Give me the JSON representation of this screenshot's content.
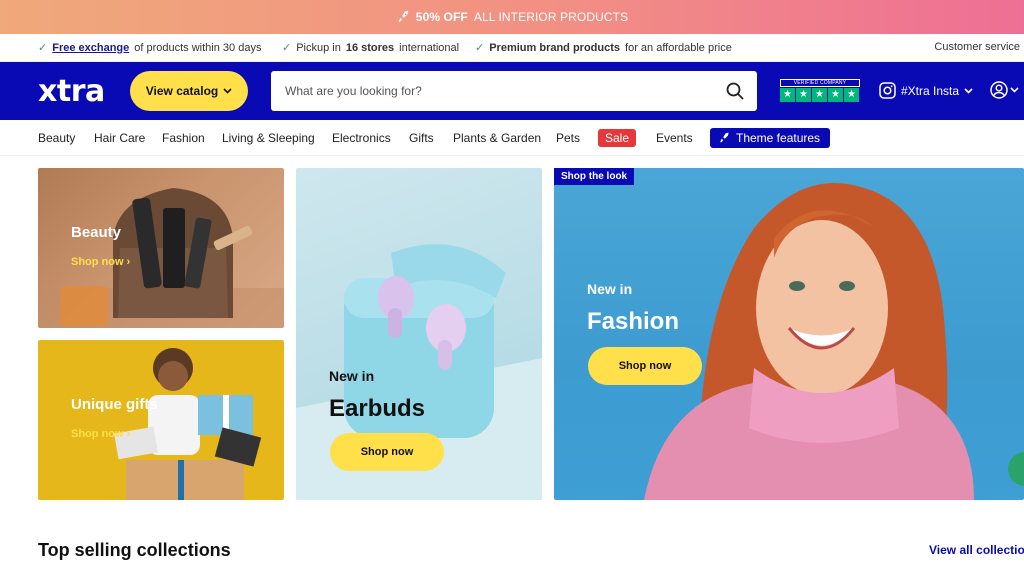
{
  "announcement": {
    "bold": "50% OFF",
    "rest": "ALL INTERIOR PRODUCTS"
  },
  "usp": {
    "item1": {
      "link": "Free exchange",
      "text": "of products within 30 days"
    },
    "item2": {
      "pre": "Pickup in",
      "bold": "16 stores",
      "post": "international"
    },
    "item3": {
      "bold": "Premium brand products",
      "post": "for an affordable price"
    },
    "right": "Customer service"
  },
  "header": {
    "logo": "xtra",
    "catalog_label": "View catalog",
    "search_placeholder": "What are you looking for?",
    "trust_label": "VERIFIED COMPANY",
    "insta_label": "#Xtra Insta"
  },
  "nav": {
    "items": [
      "Beauty",
      "Hair Care",
      "Fashion",
      "Living & Sleeping",
      "Electronics",
      "Gifts",
      "Plants & Garden",
      "Pets"
    ],
    "sale": "Sale",
    "events": "Events",
    "theme": "Theme features"
  },
  "banners": {
    "beauty": {
      "title": "Beauty",
      "link": "Shop now"
    },
    "gifts": {
      "title": "Unique gifts",
      "link": "Shop now"
    },
    "earbuds": {
      "kicker": "New in",
      "title": "Earbuds",
      "button": "Shop now"
    },
    "fashion": {
      "badge": "Shop the look",
      "kicker": "New in",
      "title": "Fashion",
      "button": "Shop now"
    }
  },
  "collections": {
    "title": "Top selling collections",
    "view_all": "View all collections"
  },
  "colors": {
    "brand": "#0a0ab5",
    "accent": "#ffe04a",
    "sale": "#e5383b",
    "trust": "#00b67a"
  }
}
